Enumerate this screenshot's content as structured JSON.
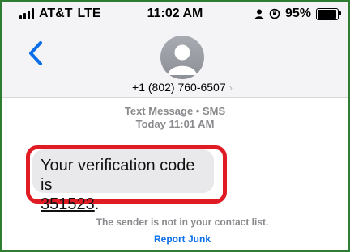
{
  "status_bar": {
    "carrier": "AT&T",
    "network": "LTE",
    "time": "11:02 AM",
    "battery": "95%",
    "battery_level": 0.95,
    "icons": [
      "signal-icon",
      "person-icon",
      "orientation-lock-icon",
      "battery-icon"
    ]
  },
  "header": {
    "back_icon": "chevron-left-icon",
    "avatar_icon": "person-placeholder-icon",
    "contact": "+1 (802) 760-6507",
    "contact_chevron": "›"
  },
  "conversation": {
    "meta_line1": "Text Message • SMS",
    "meta_line2": "Today 11:01 AM",
    "message_text": "Your verification code is",
    "message_code": "351523",
    "message_end": "."
  },
  "footer": {
    "notice": "The sender is not in your contact list.",
    "report_junk": "Report Junk"
  },
  "colors": {
    "accent": "#0a6ee8",
    "highlight_outline": "#e01b24",
    "frame_border": "#2e7d32"
  }
}
